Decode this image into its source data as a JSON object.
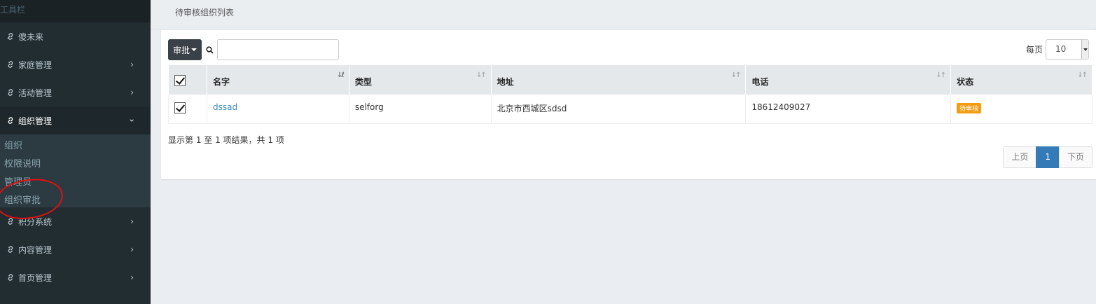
{
  "sidebar": {
    "toolbar_label": "工具栏",
    "items": [
      {
        "label": "傻未来"
      },
      {
        "label": "家庭管理"
      },
      {
        "label": "活动管理"
      },
      {
        "label": "组织管理"
      },
      {
        "label": "积分系统"
      },
      {
        "label": "内容管理"
      },
      {
        "label": "首页管理"
      }
    ],
    "submenu": [
      "组织",
      "权限说明",
      "管理员",
      "组织审批"
    ]
  },
  "header": {
    "title": "待审核组织列表"
  },
  "controls": {
    "approve_label": "审批",
    "search_placeholder": "",
    "perpage_label": "每页",
    "perpage_value": "10"
  },
  "table": {
    "columns": [
      "名字",
      "类型",
      "地址",
      "电话",
      "状态"
    ],
    "rows": [
      {
        "name": "dssad",
        "type": "selforg",
        "address": "北京市西城区sdsd",
        "phone": "18612409027",
        "status": "待审核"
      }
    ]
  },
  "summary": "显示第 1 至 1 项结果，共 1 项",
  "pagination": {
    "prev": "上页",
    "current": "1",
    "next": "下页"
  },
  "colors": {
    "sidebar_bg": "#222d32",
    "accent": "#337ab7",
    "status_pending": "#f39c12",
    "annotation": "#e01010"
  }
}
